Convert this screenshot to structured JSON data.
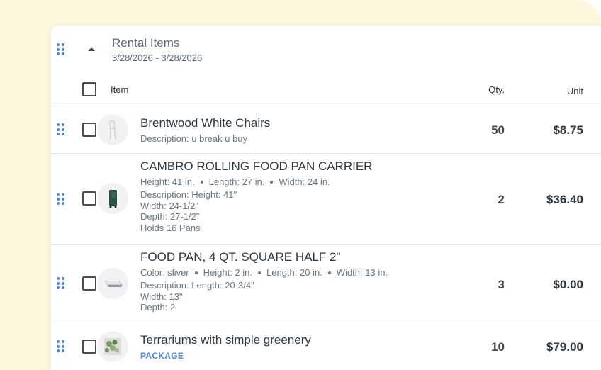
{
  "group": {
    "title": "Rental Items",
    "dates": "3/28/2026 - 3/28/2026"
  },
  "columns": {
    "item": "Item",
    "qty": "Qty.",
    "unit": "Unit"
  },
  "rows": [
    {
      "name": "Brentwood White Chairs",
      "details": [],
      "description": [
        "Description: u break u buy"
      ],
      "qty": "50",
      "price": "$8.75",
      "thumbnail": "white-chair-thumbnail"
    },
    {
      "name": "CAMBRO ROLLING FOOD PAN CARRIER",
      "details": [
        "Height: 41 in.",
        "Length: 27 in.",
        "Width: 24 in."
      ],
      "description": [
        "Description: Height: 41\"",
        "Width: 24-1/2\"",
        "Depth: 27-1/2\"",
        "Holds 16 Pans"
      ],
      "qty": "2",
      "price": "$36.40",
      "thumbnail": "food-carrier-thumbnail"
    },
    {
      "name": "FOOD PAN, 4 QT. SQUARE HALF 2\"",
      "details": [
        "Color: sliver",
        "Height: 2 in.",
        "Length: 20 in.",
        "Width: 13 in."
      ],
      "description": [
        "Description: Length: 20-3/4\"",
        "Width: 13\"",
        "Depth: 2"
      ],
      "qty": "3",
      "price": "$0.00",
      "thumbnail": "food-pan-thumbnail"
    },
    {
      "name": "Terrariums with simple greenery",
      "badge": "PACKAGE",
      "qty": "10",
      "price": "$79.00",
      "thumbnail": "terrarium-thumbnail"
    }
  ],
  "colors": {
    "accent": "#4a86d8",
    "background": "#fdf7de",
    "text": "#303840"
  }
}
